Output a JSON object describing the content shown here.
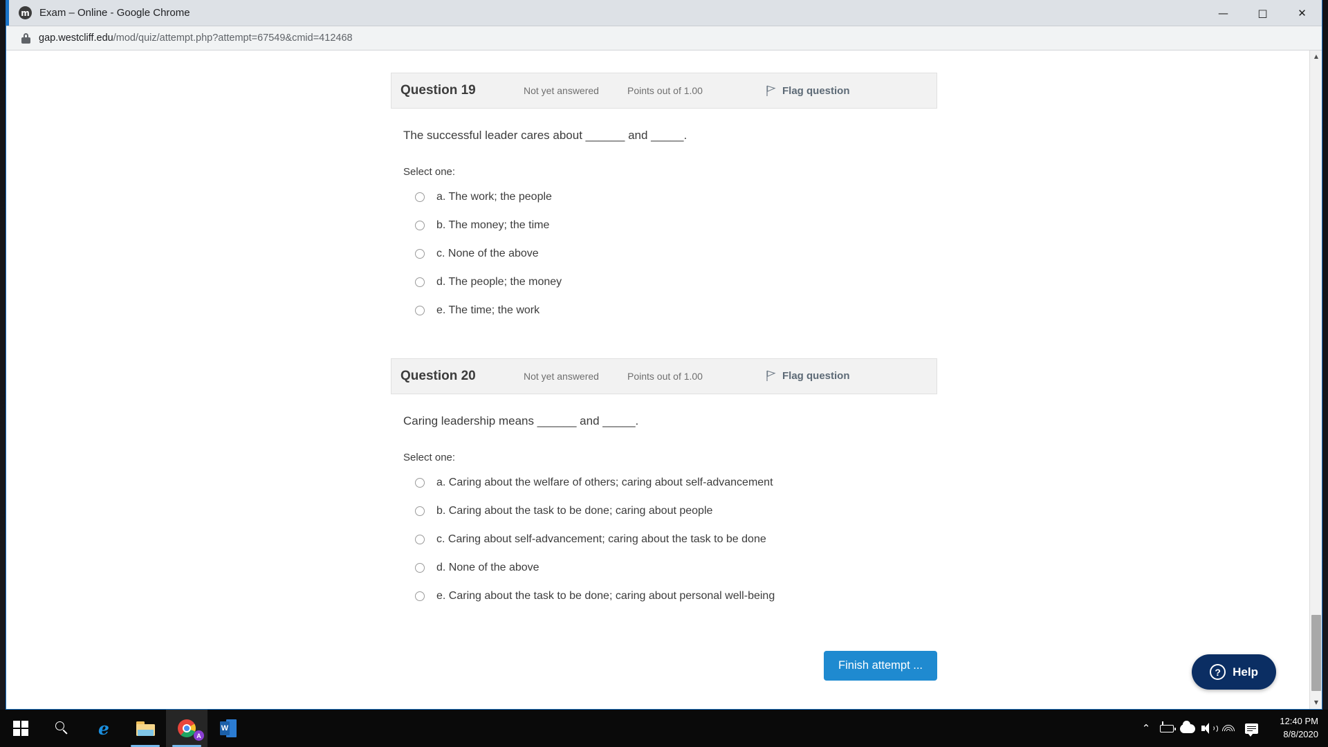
{
  "window": {
    "title": "Exam – Online - Google Chrome",
    "favicon": "moodle-icon",
    "favicon_letter": "m",
    "controls": {
      "minimize": "—",
      "maximize": "□",
      "close": "✕"
    }
  },
  "urlbar": {
    "lock": "lock-icon",
    "host": "gap.westcliff.edu",
    "path": "/mod/quiz/attempt.php?attempt=67549&cmid=412468"
  },
  "questions": [
    {
      "number": "Question 19",
      "state": "Not yet answered",
      "points": "Points out of 1.00",
      "flag_label": "Flag question",
      "text": "The successful leader cares about ______ and _____.",
      "select_label": "Select one:",
      "options": [
        "a. The work; the people",
        "b. The money; the time",
        "c. None of the above",
        "d. The people; the money",
        "e. The time; the work"
      ]
    },
    {
      "number": "Question 20",
      "state": "Not yet answered",
      "points": "Points out of 1.00",
      "flag_label": "Flag question",
      "text": "Caring leadership means ______ and _____.",
      "select_label": "Select one:",
      "options": [
        "a. Caring about the welfare of others; caring about self-advancement",
        "b. Caring about the task to be done; caring about people",
        "c. Caring about self-advancement; caring about the task to be done",
        "d. None of the above",
        "e. Caring about the task to be done; caring about personal well-being"
      ]
    }
  ],
  "footer": {
    "finish_attempt": "Finish attempt ..."
  },
  "help_widget": {
    "label": "Help",
    "icon_char": "?"
  },
  "taskbar": {
    "items": [
      {
        "name": "start-button",
        "icon": "windows-logo-icon"
      },
      {
        "name": "search-button",
        "icon": "search-icon"
      },
      {
        "name": "edge-button",
        "icon": "edge-icon",
        "letter": "e"
      },
      {
        "name": "file-explorer-button",
        "icon": "folder-icon"
      },
      {
        "name": "chrome-button",
        "icon": "chrome-icon",
        "badge": "A"
      },
      {
        "name": "word-button",
        "icon": "word-icon",
        "letter": "W"
      }
    ],
    "tray": [
      {
        "name": "show-hidden-icons",
        "icon": "chevron-up-icon",
        "glyph": "⌃"
      },
      {
        "name": "battery-icon",
        "icon": "battery-icon"
      },
      {
        "name": "onedrive-icon",
        "icon": "cloud-icon"
      },
      {
        "name": "volume-icon",
        "icon": "speaker-icon"
      },
      {
        "name": "network-icon",
        "icon": "wifi-icon"
      },
      {
        "name": "notifications-icon",
        "icon": "speech-bubble-icon"
      }
    ],
    "clock": {
      "time": "12:40 PM",
      "date": "8/8/2020"
    }
  },
  "colors": {
    "accent_blue": "#1f8ad0",
    "help_navy": "#0b2e63",
    "card_bg": "#f2f2f2",
    "text": "#3c3c3c",
    "muted": "#6f6f6f",
    "flag_label": "#5d6a76"
  }
}
